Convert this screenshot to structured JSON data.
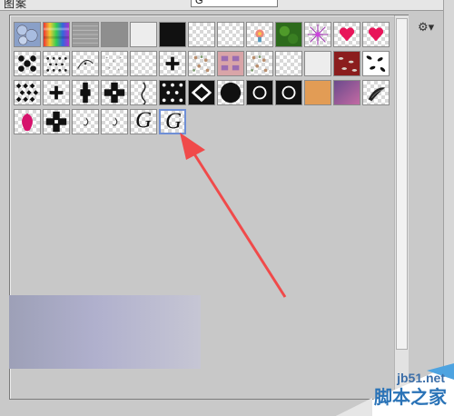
{
  "window": {
    "partial_title": "图案",
    "field_value": "G"
  },
  "panel_menu": {
    "icon": "gear-icon",
    "glyph": "⚙▾"
  },
  "presets": {
    "rows": [
      [
        {
          "name": "bubbles",
          "kind": "bubbles"
        },
        {
          "name": "tie-dye",
          "kind": "rainbow"
        },
        {
          "name": "gray-texture",
          "kind": "texture-gray"
        },
        {
          "name": "gray-solid",
          "kind": "gray"
        },
        {
          "name": "light-gray",
          "kind": "light"
        },
        {
          "name": "black",
          "kind": "black"
        },
        {
          "name": "transparent-1",
          "kind": "blank"
        },
        {
          "name": "transparent-2",
          "kind": "blank"
        },
        {
          "name": "flower-small",
          "kind": "flower"
        },
        {
          "name": "green",
          "kind": "green"
        },
        {
          "name": "purple-burst",
          "kind": "burst"
        },
        {
          "name": "heart-1",
          "kind": "heart"
        },
        {
          "name": "heart-2",
          "kind": "heart"
        }
      ],
      [
        {
          "name": "black-blob",
          "kind": "blob"
        },
        {
          "name": "dots",
          "kind": "dots"
        },
        {
          "name": "wisp",
          "kind": "wisp"
        },
        {
          "name": "light-dots",
          "kind": "lightdots"
        },
        {
          "name": "transparent-3",
          "kind": "blank"
        },
        {
          "name": "tiny-cross",
          "kind": "cross"
        },
        {
          "name": "floral-a",
          "kind": "floral"
        },
        {
          "name": "pink-pattern",
          "kind": "pinkpattern"
        },
        {
          "name": "floral-b",
          "kind": "floral"
        },
        {
          "name": "transparent-4",
          "kind": "blank"
        },
        {
          "name": "light",
          "kind": "light"
        },
        {
          "name": "red-leaves",
          "kind": "redleaves"
        },
        {
          "name": "black-leaves",
          "kind": "blackleaves"
        }
      ],
      [
        {
          "name": "diamonds",
          "kind": "diamonds"
        },
        {
          "name": "cross-small",
          "kind": "cross"
        },
        {
          "name": "vertical-pillar",
          "kind": "pillar"
        },
        {
          "name": "cross-big",
          "kind": "crossbig"
        },
        {
          "name": "wavy",
          "kind": "wavy"
        },
        {
          "name": "check-pattern",
          "kind": "checkblack"
        },
        {
          "name": "diamond-black",
          "kind": "diamondblack"
        },
        {
          "name": "circle-black",
          "kind": "circleblack"
        },
        {
          "name": "octagon-black",
          "kind": "octagonblack"
        },
        {
          "name": "octagon-black-2",
          "kind": "octagonblack"
        },
        {
          "name": "orange",
          "kind": "orange"
        },
        {
          "name": "violet-sky",
          "kind": "violet"
        },
        {
          "name": "feather",
          "kind": "feather"
        }
      ],
      [
        {
          "name": "pink-petal",
          "kind": "petal"
        },
        {
          "name": "cross-arrow",
          "kind": "crossbig"
        },
        {
          "name": "comma-1",
          "kind": "comma"
        },
        {
          "name": "comma-2",
          "kind": "comma"
        },
        {
          "name": "letter-g-1",
          "kind": "letterg",
          "text": "G"
        },
        {
          "name": "letter-g-2",
          "kind": "letterg",
          "text": "G",
          "selected": true
        }
      ]
    ]
  },
  "watermark": {
    "site": "jb51.net",
    "cn": "脚本之家"
  },
  "colors": {
    "arrow": "#f04a4a",
    "selection": "#6f8fd6"
  }
}
